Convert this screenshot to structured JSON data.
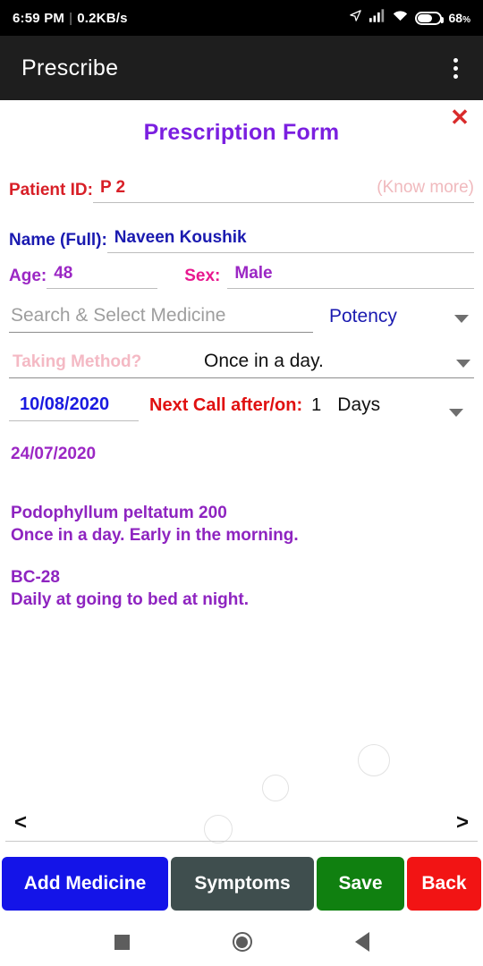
{
  "status_bar": {
    "time": "6:59 PM",
    "separator": "|",
    "network_speed": "0.2KB/s",
    "battery_percent": "68",
    "percent_symbol": "%",
    "icons": [
      "location-arrow-icon",
      "signal-bars-icon",
      "wifi-icon",
      "battery-icon"
    ]
  },
  "app_bar": {
    "title": "Prescribe",
    "overflow_icon": "kebab-menu-icon"
  },
  "form": {
    "title": "Prescription Form",
    "close_label": "✕",
    "patient_id_label": "Patient ID:",
    "patient_id_value": "P 2",
    "know_more": "(Know more)",
    "name_label": "Name (Full):",
    "name_value": "Naveen Koushik",
    "age_label": "Age:",
    "age_value": "48",
    "sex_label": "Sex:",
    "sex_value": "Male",
    "medicine_placeholder": "Search & Select Medicine",
    "potency_label": "Potency",
    "taking_method_label": "Taking Method?",
    "taking_method_value": "Once in a day.",
    "date_value": "10/08/2020",
    "next_call_label": "Next Call after/on:",
    "next_call_number": "1",
    "next_call_unit": "Days"
  },
  "prescription": {
    "date": "24/07/2020",
    "items": [
      {
        "medicine": "Podophyllum peltatum 200",
        "instruction": "Once in a day. Early in the morning."
      },
      {
        "medicine": "BC-28",
        "instruction": "Daily at going to bed at night."
      }
    ]
  },
  "pager": {
    "prev": "<",
    "next": ">"
  },
  "buttons": {
    "add_medicine": "Add Medicine",
    "symptoms": "Symptoms",
    "save": "Save",
    "back": "Back"
  },
  "colors": {
    "accent_violet": "#7b1fe0",
    "label_red": "#d81f27",
    "value_blue": "#1a1ab0",
    "purple": "#9b27c4",
    "magenta": "#e8188f",
    "pink_light": "#f4b9c4",
    "btn_add": "#1414e8",
    "btn_symptoms": "#3f4e4e",
    "btn_save": "#108010",
    "btn_back": "#f21414"
  },
  "android_nav": {
    "recents": "square-recents-icon",
    "home": "circle-home-icon",
    "back": "triangle-back-icon"
  }
}
